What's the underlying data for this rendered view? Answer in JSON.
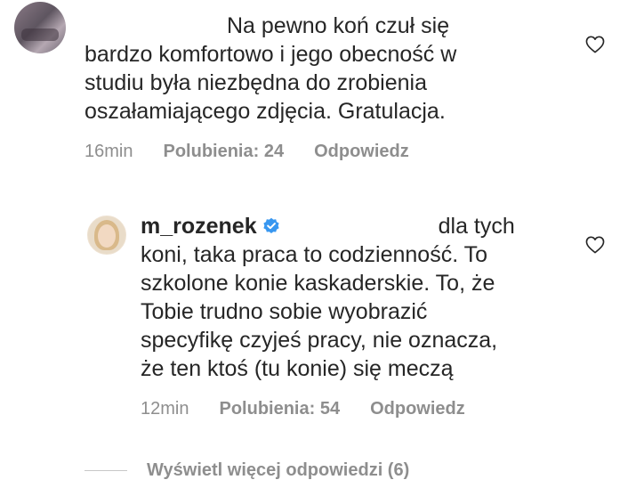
{
  "comments": [
    {
      "lines": [
        "Na pewno koń czuł się",
        "bardzo komfortowo i jego obecność w",
        "studiu była niezbędna do zrobienia",
        "oszałamiającego zdjęcia. Gratulacja."
      ],
      "time": "16min",
      "likes": "Polubienia: 24",
      "reply": "Odpowiedz",
      "icon": "heart-outline-icon"
    },
    {
      "username": "m_rozenek",
      "verified": true,
      "first_line_tail": "dla tych",
      "lines": [
        "koni, taka praca to codzienność. To",
        "szkolone konie kaskaderskie. To, że",
        "Tobie trudno sobie wyobrazić",
        "specyfikę czyjeś pracy, nie oznacza,",
        "że ten ktoś (tu konie) się meczą"
      ],
      "time": "12min",
      "likes": "Polubienia: 54",
      "reply": "Odpowiedz",
      "icon": "heart-outline-icon"
    }
  ],
  "view_more": "Wyświetl więcej odpowiedzi (6)",
  "colors": {
    "text": "#262626",
    "meta": "#8e8e8e",
    "verified": "#3897f0"
  }
}
